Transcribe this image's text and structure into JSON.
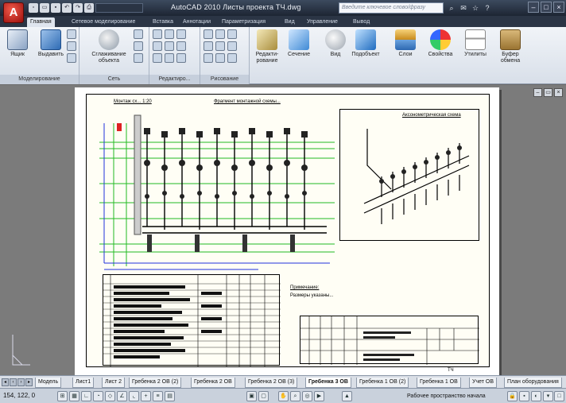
{
  "app": {
    "title": "AutoCAD 2010   Листы проекта ТЧ.dwg",
    "logo": "A",
    "search_placeholder": "Введите ключевое слово/фразу"
  },
  "qat": {
    "workspace_dropdown": ""
  },
  "ribbon_tabs": [
    "Главная",
    "Сетевое моделирование",
    "Вставка",
    "Аннотации",
    "Параметризация",
    "Вид",
    "Управление",
    "Вывод"
  ],
  "ribbon": {
    "panels": {
      "modeling": "Моделирование",
      "mesh": "Сеть",
      "edit": "Редактиро...",
      "draw": "Рисование"
    },
    "buttons": {
      "box": "Ящик",
      "extrude": "Выдавить",
      "smooth": "Сглаживание объекта",
      "edit_fx": "Редакти-рование",
      "section": "Сечение",
      "view": "Вид",
      "subobject": "Подобъект",
      "layers": "Слои",
      "properties": "Свойства",
      "utilities": "Утилиты",
      "clipboard": "Буфер обмена"
    }
  },
  "drawing": {
    "left_title": "Монтаж сх... 1:20",
    "top_title": "Фрагмент монтажной схемы...",
    "iso_title": "Аксонометрическая схема",
    "notes_title": "Примечание:",
    "notes_text": "Размеры указаны...",
    "stamp_small": "ТЧ"
  },
  "layout_tabs": [
    "Модель",
    "Лист1",
    "Лист 2",
    "Гребенка 2 ОВ (2)",
    "Гребенка 2 ОВ",
    "Гребенка 2 ОВ (3)",
    "Гребенка 3 ОВ",
    "Гребенка 1 ОВ (2)",
    "Гребенка 1 ОВ",
    "Учет ОВ",
    "План оборудования"
  ],
  "status": {
    "coords": "154, 122, 0",
    "workspace": "Рабочее пространство начала"
  }
}
